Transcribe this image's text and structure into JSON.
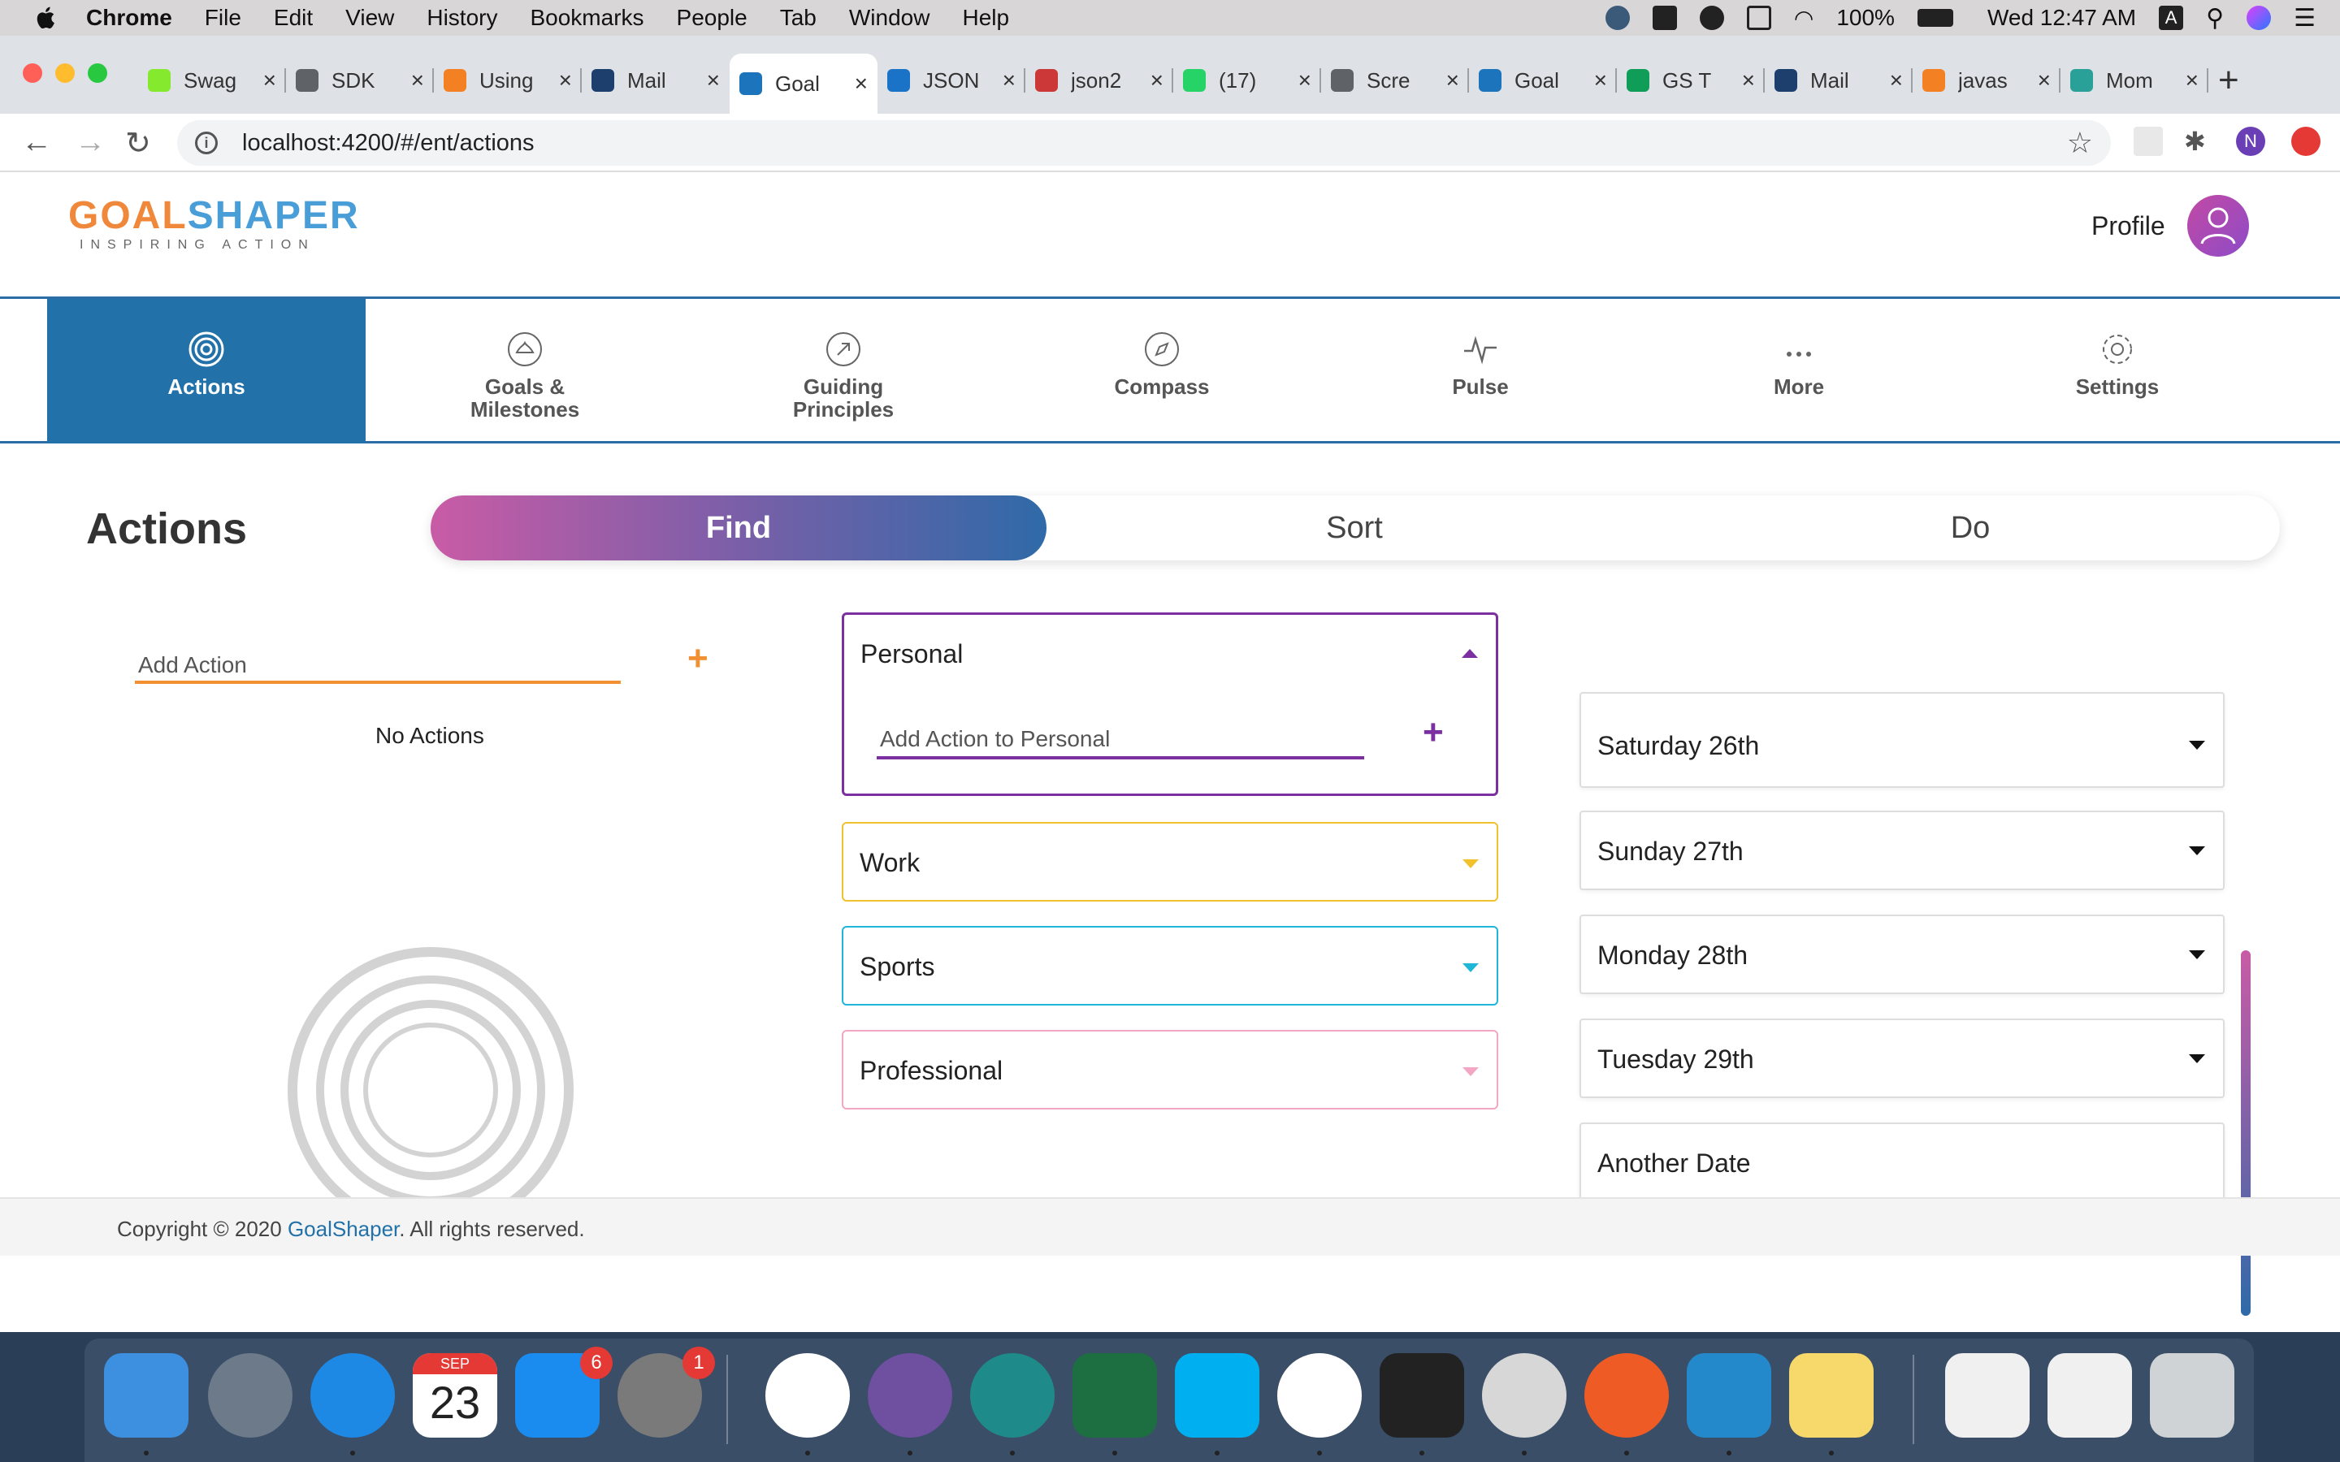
{
  "menubar": {
    "app_name": "Chrome",
    "items": [
      "File",
      "Edit",
      "View",
      "History",
      "Bookmarks",
      "People",
      "Tab",
      "Window",
      "Help"
    ],
    "battery": "100%",
    "clock": "Wed 12:47 AM",
    "input_source": "A"
  },
  "browser": {
    "tabs": [
      {
        "title": "Swag",
        "icon": "swagger-icon",
        "color": "#85ea2d"
      },
      {
        "title": "SDK",
        "icon": "globe-icon",
        "color": "#5f6368"
      },
      {
        "title": "Using",
        "icon": "stackoverflow-icon",
        "color": "#f48024"
      },
      {
        "title": "Mail",
        "icon": "mail-icon",
        "color": "#1d3f6e"
      },
      {
        "title": "Goal",
        "icon": "gs-icon",
        "color": "#1c75bc"
      },
      {
        "title": "JSON",
        "icon": "json-icon",
        "color": "#1a73c7"
      },
      {
        "title": "json2",
        "icon": "npm-icon",
        "color": "#cb3837"
      },
      {
        "title": "(17)",
        "icon": "whatsapp-icon",
        "color": "#25d366"
      },
      {
        "title": "Scre",
        "icon": "globe-icon",
        "color": "#5f6368"
      },
      {
        "title": "Goal",
        "icon": "gs-icon",
        "color": "#1c75bc"
      },
      {
        "title": "GS T",
        "icon": "sheets-icon",
        "color": "#0f9d58"
      },
      {
        "title": "Mail",
        "icon": "mail-icon",
        "color": "#1d3f6e"
      },
      {
        "title": "javas",
        "icon": "stackoverflow-icon",
        "color": "#f48024"
      },
      {
        "title": "Mom",
        "icon": "clock-icon",
        "color": "#2aa198"
      }
    ],
    "active_tab_index": 4,
    "url": "localhost:4200/#/ent/actions",
    "profile_initial": "N"
  },
  "app": {
    "logo": {
      "goal": "GOAL",
      "shaper": "SHAPER",
      "tagline": "INSPIRING ACTION"
    },
    "profile_label": "Profile",
    "nav": [
      {
        "label": "Actions",
        "icon": "target-icon",
        "active": true
      },
      {
        "label": "Goals &\nMilestones",
        "icon": "lotus-icon",
        "active": false
      },
      {
        "label": "Guiding\nPrinciples",
        "icon": "arrow-circle-icon",
        "active": false
      },
      {
        "label": "Compass",
        "icon": "compass-icon",
        "active": false
      },
      {
        "label": "Pulse",
        "icon": "pulse-icon",
        "active": false
      },
      {
        "label": "More",
        "icon": "more-dots-icon",
        "active": false
      },
      {
        "label": "Settings",
        "icon": "gear-icon",
        "active": false
      }
    ],
    "page_title": "Actions",
    "segments": {
      "find": "Find",
      "sort": "Sort",
      "do": "Do"
    },
    "add_action_placeholder": "Add Action",
    "no_actions": "No Actions",
    "categories": [
      {
        "name": "Personal",
        "color": "#7b2fa0",
        "expanded": true,
        "add_placeholder": "Add Action to Personal"
      },
      {
        "name": "Work",
        "color": "#f2c12e",
        "expanded": false
      },
      {
        "name": "Sports",
        "color": "#1fb6d8",
        "expanded": false
      },
      {
        "name": "Professional",
        "color": "#f3a7c4",
        "expanded": false
      }
    ],
    "dates": [
      "Saturday 26th",
      "Sunday 27th",
      "Monday 28th",
      "Tuesday 29th",
      "Another Date"
    ],
    "footer": {
      "prefix": "Copyright © 2020 ",
      "link": "GoalShaper",
      "suffix": ". All rights reserved."
    }
  },
  "dock": {
    "apps": [
      "Finder",
      "Launchpad",
      "Safari",
      "Calendar",
      "App Store",
      "System Preferences",
      "Slack",
      "GitHub Desktop",
      "Webex",
      "Excel",
      "Skype",
      "Chrome",
      "Terminal",
      "Cisco AnyConnect",
      "Postman",
      "VS Code",
      "Notes",
      "PDF",
      "Spreadsheet",
      "Trash"
    ],
    "calendar_month": "SEP",
    "calendar_day": "23",
    "appstore_badge": "6",
    "sysprefs_badge": "1"
  }
}
